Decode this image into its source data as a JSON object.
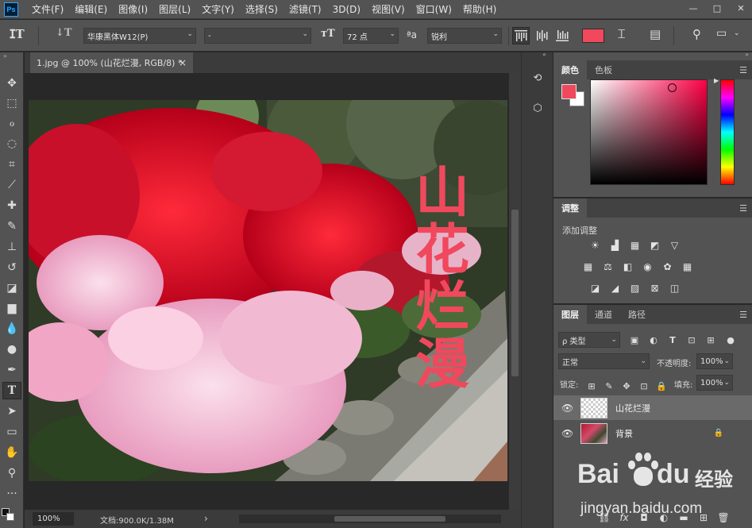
{
  "app": {
    "logo": "Ps"
  },
  "menu": [
    "文件(F)",
    "编辑(E)",
    "图像(I)",
    "图层(L)",
    "文字(Y)",
    "选择(S)",
    "滤镜(T)",
    "3D(D)",
    "视图(V)",
    "窗口(W)",
    "帮助(H)"
  ],
  "window_controls": {
    "minimize": "—",
    "restore": "□",
    "close": "✕"
  },
  "options": {
    "font_family": "华康黑体W12(P)",
    "font_style": "-",
    "font_size": "72 点",
    "aa_icon": "ªa",
    "antialias": "锐利",
    "text_color": "#f0485c"
  },
  "document": {
    "tab_title": "1.jpg @ 100% (山花烂漫, RGB/8) *",
    "close": "×",
    "overlay_text": [
      "山",
      "花",
      "烂",
      "漫"
    ],
    "text_color": "#f0485c"
  },
  "status": {
    "zoom": "100%",
    "doc_info": "文档:900.0K/1.38M",
    "arrow": "›"
  },
  "panels": {
    "color": {
      "tabs": [
        "颜色",
        "色板"
      ],
      "fg": "#f0485c",
      "bg": "#ffffff"
    },
    "adjust": {
      "tab": "调整",
      "title": "添加调整"
    },
    "layers": {
      "tabs": [
        "图层",
        "通道",
        "路径"
      ],
      "filter_kind": "ρ 类型",
      "blend_mode": "正常",
      "opacity_label": "不透明度:",
      "opacity": "100%",
      "lock_label": "锁定:",
      "fill_label": "填充:",
      "fill": "100%",
      "items": [
        {
          "name": "山花烂漫",
          "type": "text",
          "selected": true
        },
        {
          "name": "背景",
          "type": "image",
          "locked": true
        }
      ]
    }
  },
  "watermark": {
    "brand": "Bai",
    "brand2": "du",
    "cn": "经验",
    "url": "jingyan.baidu.com"
  }
}
